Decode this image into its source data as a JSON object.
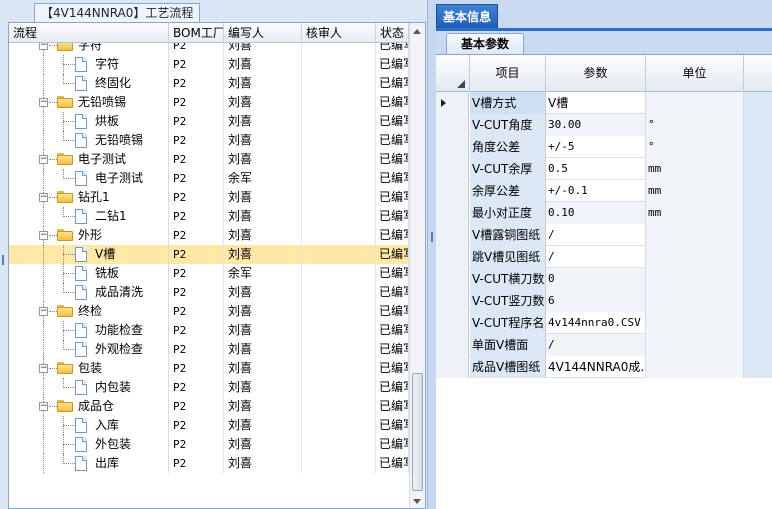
{
  "left_panel": {
    "tab_title": "【4V144NNRA0】工艺流程",
    "columns": [
      "流程",
      "BOM工厂",
      "编写人",
      "核审人",
      "状态"
    ],
    "rows": [
      {
        "label": "字符",
        "level": 0,
        "type": "folder",
        "bom": "P2",
        "editor": "刘喜",
        "reviewer": "",
        "status": "已编写",
        "partial": true
      },
      {
        "label": "字符",
        "level": 1,
        "type": "file",
        "bom": "P2",
        "editor": "刘喜",
        "reviewer": "",
        "status": "已编写"
      },
      {
        "label": "终固化",
        "level": 1,
        "type": "file",
        "bom": "P2",
        "editor": "刘喜",
        "reviewer": "",
        "status": "已编写"
      },
      {
        "label": "无铅喷锡",
        "level": 0,
        "type": "folder",
        "bom": "P2",
        "editor": "刘喜",
        "reviewer": "",
        "status": "已编写"
      },
      {
        "label": "烘板",
        "level": 1,
        "type": "file",
        "bom": "P2",
        "editor": "刘喜",
        "reviewer": "",
        "status": "已编写"
      },
      {
        "label": "无铅喷锡",
        "level": 1,
        "type": "file",
        "bom": "P2",
        "editor": "刘喜",
        "reviewer": "",
        "status": "已编写"
      },
      {
        "label": "电子测试",
        "level": 0,
        "type": "folder",
        "bom": "P2",
        "editor": "刘喜",
        "reviewer": "",
        "status": "已编写"
      },
      {
        "label": "电子测试",
        "level": 1,
        "type": "file",
        "bom": "P2",
        "editor": "余军",
        "reviewer": "",
        "status": "已编写"
      },
      {
        "label": "钻孔1",
        "level": 0,
        "type": "folder",
        "bom": "P2",
        "editor": "刘喜",
        "reviewer": "",
        "status": "已编写"
      },
      {
        "label": "二钻1",
        "level": 1,
        "type": "file",
        "bom": "P2",
        "editor": "刘喜",
        "reviewer": "",
        "status": "已编写"
      },
      {
        "label": "外形",
        "level": 0,
        "type": "folder",
        "bom": "P2",
        "editor": "刘喜",
        "reviewer": "",
        "status": "已编写"
      },
      {
        "label": "V槽",
        "level": 1,
        "type": "file",
        "bom": "P2",
        "editor": "刘喜",
        "reviewer": "",
        "status": "已编写",
        "selected": true
      },
      {
        "label": "铣板",
        "level": 1,
        "type": "file",
        "bom": "P2",
        "editor": "余军",
        "reviewer": "",
        "status": "已编写"
      },
      {
        "label": "成品清洗",
        "level": 1,
        "type": "file",
        "bom": "P2",
        "editor": "刘喜",
        "reviewer": "",
        "status": "已编写"
      },
      {
        "label": "终检",
        "level": 0,
        "type": "folder",
        "bom": "P2",
        "editor": "刘喜",
        "reviewer": "",
        "status": "已编写"
      },
      {
        "label": "功能检查",
        "level": 1,
        "type": "file",
        "bom": "P2",
        "editor": "刘喜",
        "reviewer": "",
        "status": "已编写"
      },
      {
        "label": "外观检查",
        "level": 1,
        "type": "file",
        "bom": "P2",
        "editor": "刘喜",
        "reviewer": "",
        "status": "已编写"
      },
      {
        "label": "包装",
        "level": 0,
        "type": "folder",
        "bom": "P2",
        "editor": "刘喜",
        "reviewer": "",
        "status": "已编写"
      },
      {
        "label": "内包装",
        "level": 1,
        "type": "file",
        "bom": "P2",
        "editor": "刘喜",
        "reviewer": "",
        "status": "已编写"
      },
      {
        "label": "成品仓",
        "level": 0,
        "type": "folder",
        "bom": "P2",
        "editor": "刘喜",
        "reviewer": "",
        "status": "已编写"
      },
      {
        "label": "入库",
        "level": 1,
        "type": "file",
        "bom": "P2",
        "editor": "刘喜",
        "reviewer": "",
        "status": "已编写"
      },
      {
        "label": "外包装",
        "level": 1,
        "type": "file",
        "bom": "P2",
        "editor": "刘喜",
        "reviewer": "",
        "status": "已编写"
      },
      {
        "label": "出库",
        "level": 1,
        "type": "file",
        "bom": "P2",
        "editor": "刘喜",
        "reviewer": "",
        "status": "已编写"
      }
    ]
  },
  "right_panel": {
    "main_tab": "基本信息",
    "sub_tab": "基本参数",
    "columns": [
      "项目",
      "参数",
      "单位"
    ],
    "rows": [
      {
        "name": "V槽方式",
        "value": "V槽",
        "unit": ""
      },
      {
        "name": "V-CUT角度",
        "value": "30.00",
        "unit": "°"
      },
      {
        "name": "角度公差",
        "value": "+/-5",
        "unit": "°"
      },
      {
        "name": "V-CUT余厚",
        "value": "0.5",
        "unit": "mm"
      },
      {
        "name": "余厚公差",
        "value": "+/-0.1",
        "unit": "mm"
      },
      {
        "name": "最小对正度",
        "value": "0.10",
        "unit": "mm"
      },
      {
        "name": "V槽露铜图纸",
        "value": "/",
        "unit": ""
      },
      {
        "name": "跳V槽见图纸",
        "value": "/",
        "unit": ""
      },
      {
        "name": "V-CUT横刀数",
        "value": "0",
        "unit": ""
      },
      {
        "name": "V-CUT竖刀数",
        "value": "6",
        "unit": ""
      },
      {
        "name": "V-CUT程序名",
        "value": "4v144nnra0.CSV",
        "unit": ""
      },
      {
        "name": "单面V槽面",
        "value": "/",
        "unit": ""
      },
      {
        "name": "成品V槽图纸",
        "value": "4V144NNRA0成...",
        "unit": ""
      }
    ]
  },
  "colors": {
    "tab_blue": "#1e5fb5",
    "selected_row": "#ffe8a6",
    "folder_yellow": "#f0c145"
  }
}
